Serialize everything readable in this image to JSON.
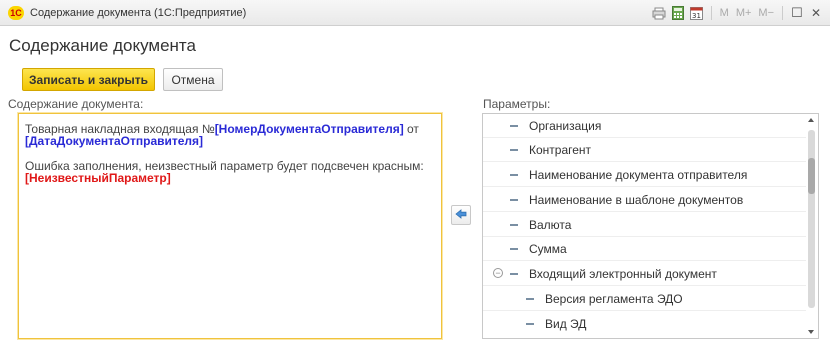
{
  "window": {
    "logo_text": "1С",
    "title": "Содержание документа  (1С:Предприятие)",
    "toolbar": {
      "m": "M",
      "m_plus": "M+",
      "m_minus": "M−",
      "restore": "☐",
      "close": "✕"
    }
  },
  "form": {
    "title": "Содержание документа",
    "save_close_label": "Записать и закрыть",
    "cancel_label": "Отмена"
  },
  "editor": {
    "label": "Содержание документа:",
    "line1_text": "Товарная накладная входящая №",
    "line1_param1": "[НомерДокументаОтправителя]",
    "line1_suffix": " от",
    "line2_param": "[ДатаДокументаОтправителя]",
    "line3_text": "Ошибка заполнения, неизвестный параметр будет подсвечен красным:",
    "line4_param": "[НеизвестныйПараметр]"
  },
  "params": {
    "label": "Параметры:",
    "items": [
      {
        "label": "Организация"
      },
      {
        "label": "Контрагент"
      },
      {
        "label": "Наименование документа отправителя"
      },
      {
        "label": "Наименование в шаблоне документов"
      },
      {
        "label": "Валюта"
      },
      {
        "label": "Сумма"
      },
      {
        "label": "Входящий электронный документ",
        "expanded": true
      },
      {
        "label": "Версия регламента ЭДО",
        "child": true
      },
      {
        "label": "Вид ЭД",
        "child": true
      }
    ]
  },
  "colors": {
    "accent_yellow": "#f3c500",
    "param_blue": "#2a2ad6",
    "param_red": "#e01818",
    "move_arrow": "#4a90d9"
  },
  "icons": {
    "move_button": "arrow-left-icon",
    "tree_collapse": "minus-circle-icon"
  }
}
